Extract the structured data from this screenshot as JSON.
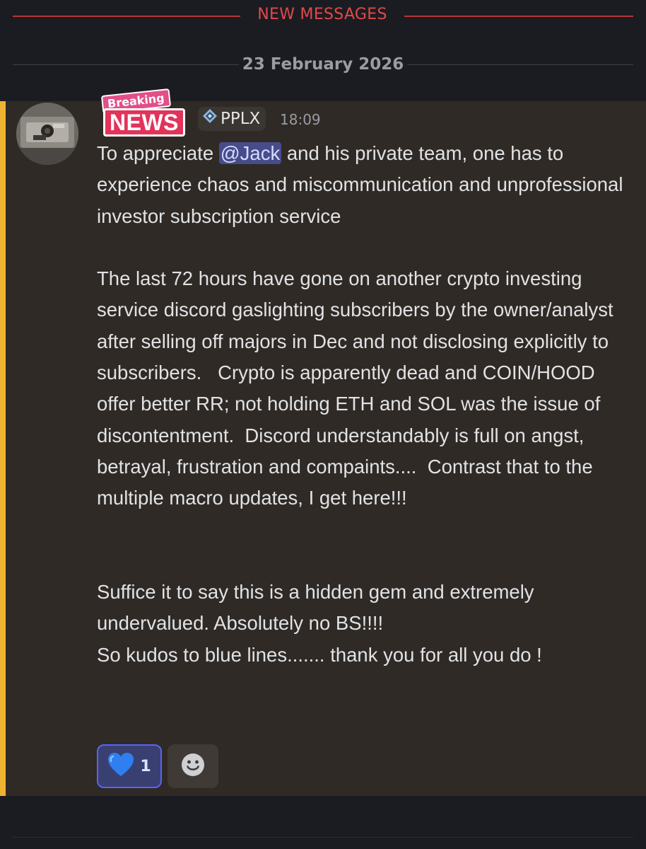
{
  "new_messages_label": "NEW MESSAGES",
  "date_label": "23 February 2026",
  "message": {
    "badge_top": "Breaking",
    "badge_main": "NEWS",
    "role_tag": "PPLX",
    "timestamp": "18:09",
    "mention": "@Jack",
    "text_before_mention": "To appreciate ",
    "text_after_mention": " and his private team, one has to experience chaos and miscommunication and unprofessional investor subscription service\n\nThe last 72 hours have gone on another crypto investing service discord gaslighting subscribers by the owner/analyst  after selling off majors in Dec and not disclosing explicitly to subscribers.   Crypto is apparently dead and COIN/HOOD offer better RR; not holding ETH and SOL was the issue of discontentment.  Discord understandably is full on angst, betrayal, frustration and compaints....  Contrast that to the multiple macro updates, I get here!!!\n\n\nSuffice it to say this is a hidden gem and extremely undervalued. Absolutely no BS!!!!\nSo kudos to blue lines....... thank you for all you do !"
  },
  "reactions": [
    {
      "emoji": "💙",
      "icon": "blue-heart-icon",
      "count": "1"
    }
  ],
  "colors": {
    "background": "#1b1c21",
    "highlight_bg": "#2f2a25",
    "highlight_bar": "#f0b232",
    "new_divider": "#e0494b",
    "mention_bg": "#474c8a",
    "reaction_border": "#5865f2"
  }
}
